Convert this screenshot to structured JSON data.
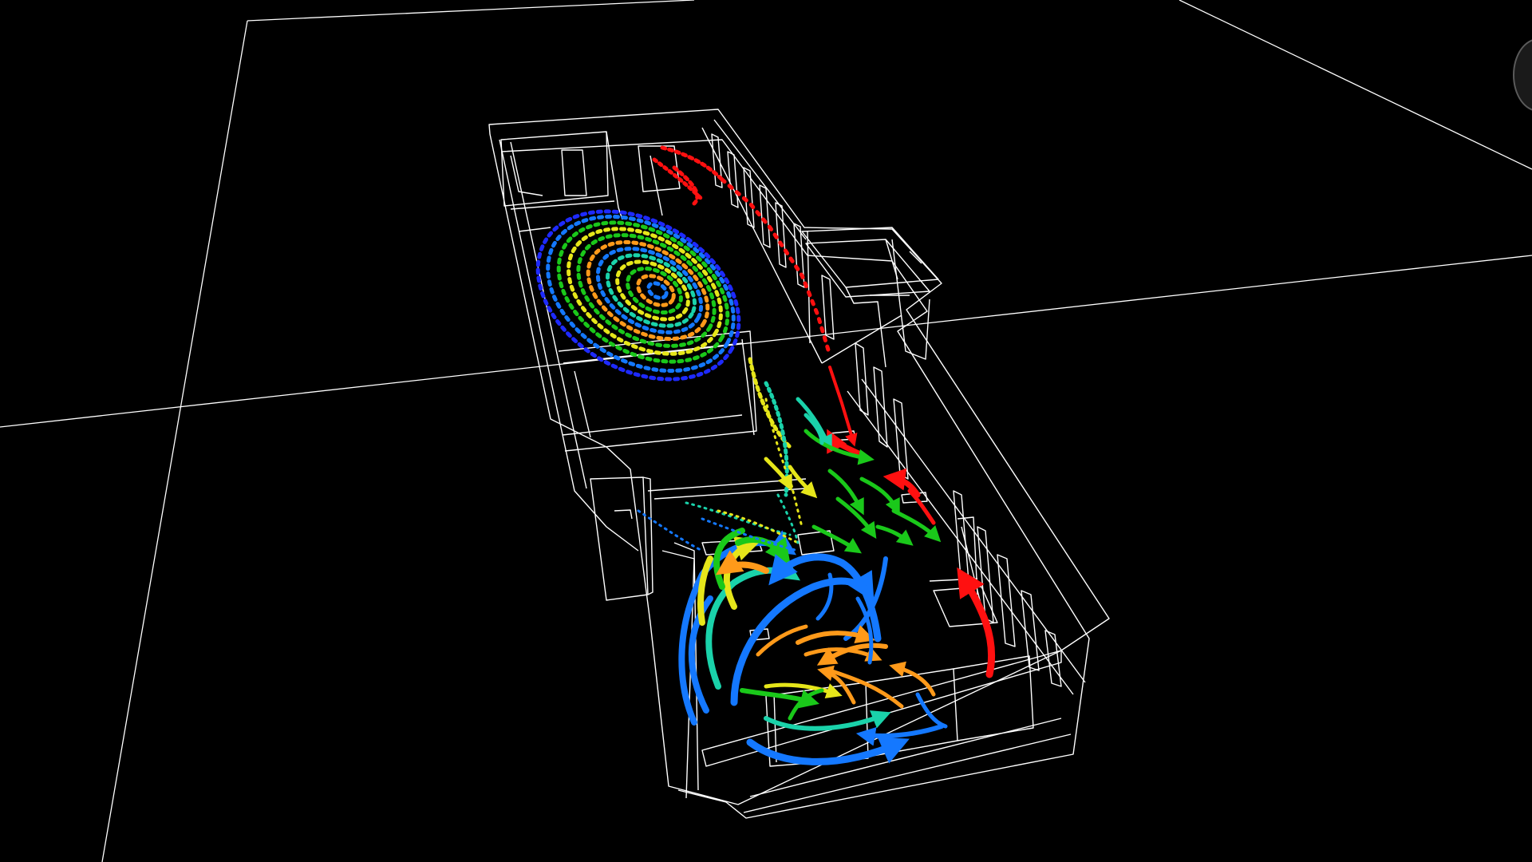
{
  "viewport": {
    "background": "#000000",
    "wireframe_color": "#ffffff",
    "icons": {
      "navigation": "navigation-gizmo-icon"
    }
  },
  "flow_colors": {
    "red": "#ff1010",
    "orange": "#ff9a1a",
    "yellow": "#e6e61a",
    "green": "#1ac81a",
    "teal": "#1ad2aa",
    "blue": "#1478ff",
    "dark_blue": "#1e2aff"
  }
}
